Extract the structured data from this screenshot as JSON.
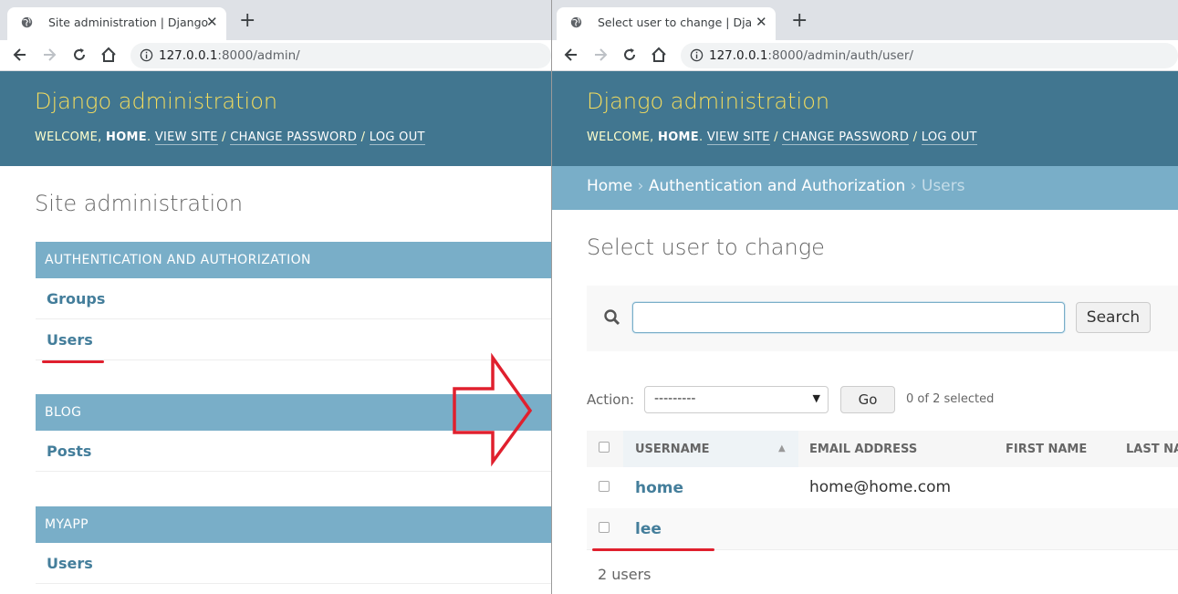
{
  "left": {
    "tab_title": "Site administration | Django site",
    "url_host": "127.0.0.1",
    "url_rest": ":8000/admin/",
    "brand": "Django administration",
    "welcome": "WELCOME, ",
    "username": "HOME",
    "view_site": "VIEW SITE",
    "change_password": "CHANGE PASSWORD",
    "log_out": "LOG OUT",
    "sep": " / ",
    "page_title": "Site administration",
    "modules": [
      {
        "caption": "AUTHENTICATION AND AUTHORIZATION",
        "items": [
          "Groups",
          "Users"
        ]
      },
      {
        "caption": "BLOG",
        "items": [
          "Posts"
        ]
      },
      {
        "caption": "MYAPP",
        "items": [
          "Users"
        ]
      }
    ]
  },
  "right": {
    "tab_title": "Select user to change | Django",
    "url_host": "127.0.0.1",
    "url_rest": ":8000/admin/auth/user/",
    "brand": "Django administration",
    "welcome": "WELCOME, ",
    "username": "HOME",
    "view_site": "VIEW SITE",
    "change_password": "CHANGE PASSWORD",
    "log_out": "LOG OUT",
    "sep": " / ",
    "breadcrumbs": [
      "Home",
      "Authentication and Authorization",
      "Users"
    ],
    "breadcrumb_sep": " › ",
    "page_title": "Select user to change",
    "search_value": "",
    "search_button": "Search",
    "action_label": "Action:",
    "action_selected": "---------",
    "go_button": "Go",
    "selection_counter": "0 of 2 selected",
    "columns": [
      "USERNAME",
      "EMAIL ADDRESS",
      "FIRST NAME",
      "LAST NAME"
    ],
    "rows": [
      {
        "username": "home",
        "email": "home@home.com"
      },
      {
        "username": "lee",
        "email": ""
      }
    ],
    "result_count": "2 users"
  },
  "annotation_color": "#e0202e",
  "colors": {
    "header": "#417690",
    "brand": "#f5dd5d",
    "module_caption": "#79aec8",
    "link": "#447e9b"
  }
}
